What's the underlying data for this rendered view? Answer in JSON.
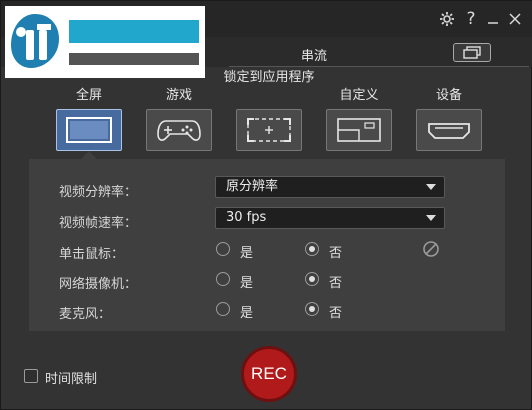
{
  "titlebar": {
    "icons": [
      "gear-icon",
      "help-icon",
      "minimize-icon",
      "close-icon"
    ],
    "help_glyph": "?"
  },
  "logo": {
    "colors": {
      "bar_top": "#22a7cc",
      "bar_bottom": "#545454",
      "mark": "#1f7fb0"
    }
  },
  "tabs": {
    "stream_label": "串流",
    "stream_icon": "screens-icon"
  },
  "modes": [
    {
      "label": "全屏",
      "icon": "fullscreen-icon",
      "active": true
    },
    {
      "label": "游戏",
      "icon": "gamepad-icon",
      "active": false
    },
    {
      "label": "锁定到应用程序",
      "icon": "lock-app-icon",
      "active": false
    },
    {
      "label": "自定义",
      "icon": "custom-region-icon",
      "active": false
    },
    {
      "label": "设备",
      "icon": "hdmi-device-icon",
      "active": false
    }
  ],
  "settings": {
    "resolution": {
      "label": "视频分辨率：",
      "value": "原分辨率"
    },
    "framerate": {
      "label": "视频帧速率：",
      "value": "30 fps"
    },
    "mouse_click": {
      "label": "单击鼠标：",
      "yes": "是",
      "no": "否",
      "selected": "否"
    },
    "webcam": {
      "label": "网络摄像机：",
      "yes": "是",
      "no": "否",
      "selected": "否"
    },
    "microphone": {
      "label": "麦克风：",
      "yes": "是",
      "no": "否",
      "selected": "否"
    }
  },
  "footer": {
    "time_limit_label": "时间限制",
    "time_limit_checked": false,
    "rec_label": "REC"
  },
  "colors": {
    "accent": "#476a9f",
    "rec": "#b11a1a",
    "panel": "#3f3f3f"
  }
}
